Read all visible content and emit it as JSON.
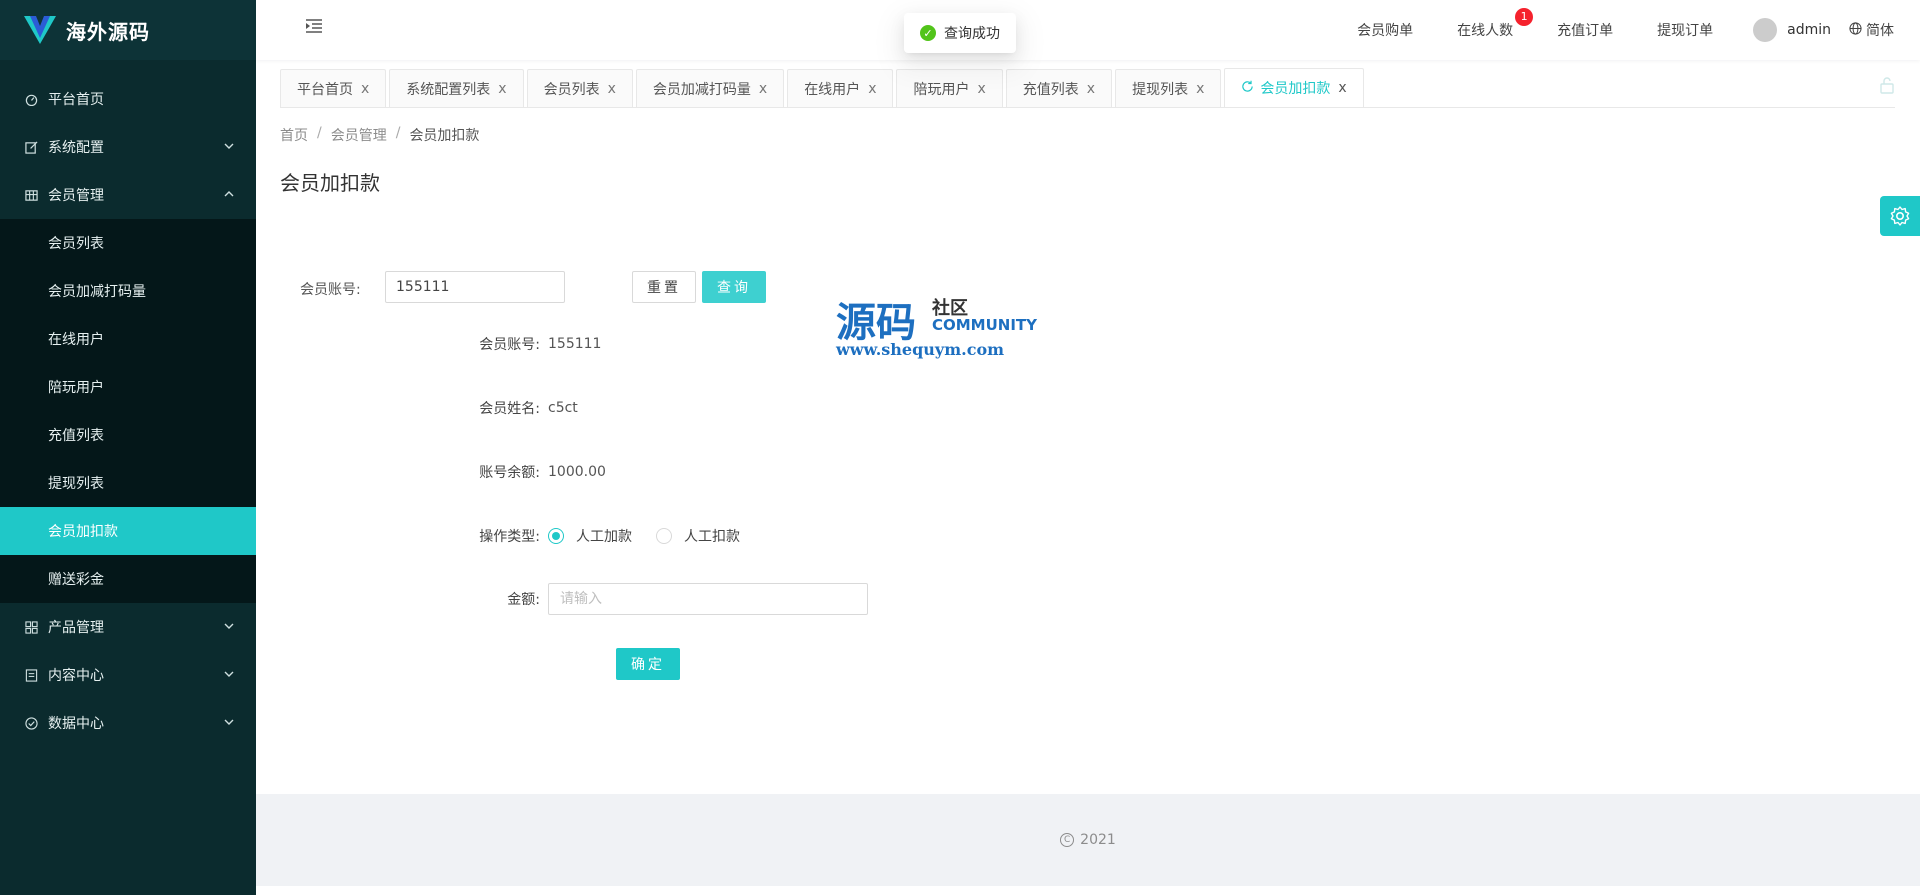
{
  "app": {
    "title": "海外源码"
  },
  "sidebar": {
    "items": [
      {
        "label": "平台首页",
        "icon": "dashboard-icon"
      },
      {
        "label": "系统配置",
        "icon": "edit-icon"
      },
      {
        "label": "会员管理",
        "icon": "table-icon"
      },
      {
        "label": "产品管理",
        "icon": "appstore-icon"
      },
      {
        "label": "内容中心",
        "icon": "profile-icon"
      },
      {
        "label": "数据中心",
        "icon": "check-circle-icon"
      }
    ],
    "submenu": [
      {
        "label": "会员列表"
      },
      {
        "label": "会员加减打码量"
      },
      {
        "label": "在线用户"
      },
      {
        "label": "陪玩用户"
      },
      {
        "label": "充值列表"
      },
      {
        "label": "提现列表"
      },
      {
        "label": "会员加扣款"
      },
      {
        "label": "赠送彩金"
      }
    ]
  },
  "header": {
    "links": [
      "会员购单",
      "在线人数",
      "充值订单",
      "提现订单"
    ],
    "online_badge": "1",
    "user": "admin",
    "lang": "简体"
  },
  "toast": {
    "text": "查询成功"
  },
  "tabs": [
    "平台首页",
    "系统配置列表",
    "会员列表",
    "会员加减打码量",
    "在线用户",
    "陪玩用户",
    "充值列表",
    "提现列表",
    "会员加扣款"
  ],
  "tab_close": "x",
  "breadcrumb": {
    "home": "首页",
    "section": "会员管理",
    "current": "会员加扣款",
    "sep": "/"
  },
  "page": {
    "title": "会员加扣款"
  },
  "search": {
    "label": "会员账号:",
    "value": "155111",
    "reset": "重置",
    "query": "查询"
  },
  "detail": {
    "account_label": "会员账号:",
    "account_value": "155111",
    "name_label": "会员姓名:",
    "name_value": "c5ct",
    "balance_label": "账号余额:",
    "balance_value": "1000.00",
    "op_label": "操作类型:",
    "op_add": "人工加款",
    "op_deduct": "人工扣款",
    "amount_label": "金额:",
    "amount_placeholder": "请输入",
    "confirm": "确定"
  },
  "watermark": {
    "big": "源码",
    "small": "社区",
    "community": "COMMUNITY",
    "url": "www.shequym.com"
  },
  "footer": {
    "copyright_symbol": "C",
    "year": "2021"
  },
  "colors": {
    "accent": "#1fc8c8",
    "sidebar_bg": "#0b2b2e",
    "badge": "#f5222d",
    "success": "#52c41a"
  }
}
